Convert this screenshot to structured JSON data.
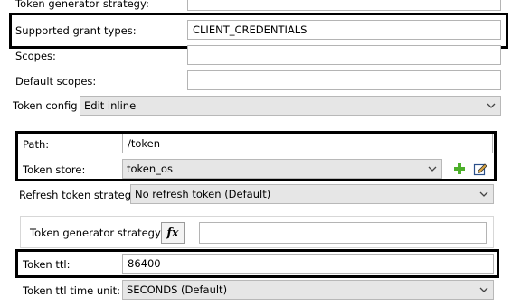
{
  "top_row": {
    "label": "Token generator strategy:"
  },
  "grant_types": {
    "label": "Supported grant types:",
    "value": "CLIENT_CREDENTIALS"
  },
  "scopes": {
    "label": "Scopes:",
    "value": ""
  },
  "default_scopes": {
    "label": "Default scopes:",
    "value": ""
  },
  "token_config": {
    "label": "Token config",
    "selected": "Edit inline"
  },
  "path": {
    "label": "Path:",
    "value": "/token"
  },
  "token_store": {
    "label": "Token store:",
    "selected": "token_os",
    "add_icon": "plus-icon",
    "edit_icon": "edit-icon"
  },
  "refresh_strategy": {
    "label": "Refresh token strategy",
    "selected": "No refresh token (Default)"
  },
  "inner_generator": {
    "label": "Token generator strategy:",
    "fx_label": "fx",
    "value": ""
  },
  "token_ttl": {
    "label": "Token ttl:",
    "value": "86400"
  },
  "ttl_unit": {
    "label": "Token ttl time unit:",
    "selected": "SECONDS (Default)"
  },
  "colors": {
    "highlight_border": "#000000",
    "field_border": "#b4b4b4",
    "combo_grey": "#e6e6e6",
    "plus_green": "#4caf2a"
  }
}
